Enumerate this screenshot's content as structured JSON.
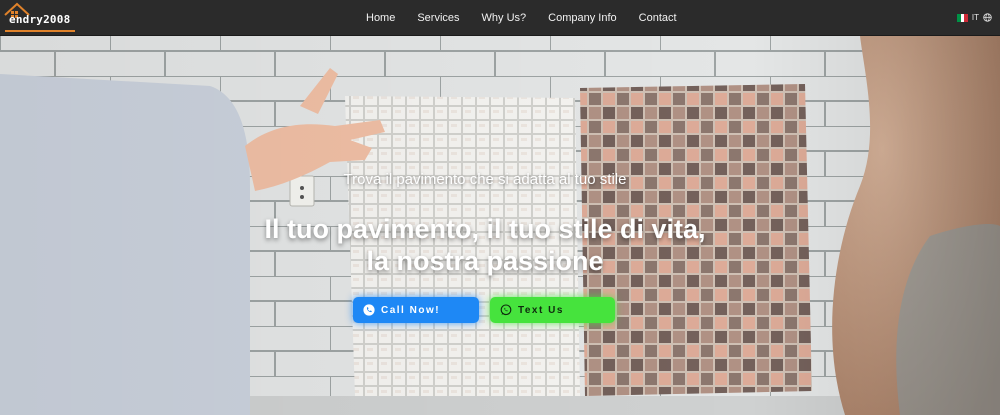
{
  "brand": {
    "logo_text": "endry2008",
    "accent": "#e0822a"
  },
  "nav": {
    "links": [
      "Home",
      "Services",
      "Why Us?",
      "Company Info",
      "Contact"
    ],
    "language": "IT",
    "flag_colors": [
      "#009246",
      "#ffffff",
      "#ce2b37"
    ]
  },
  "hero": {
    "tagline": "Trova il pavimento che si adatta al tuo stile",
    "headline_line1": "Il tuo pavimento, il tuo stile di vita,",
    "headline_line2": "la nostra passione",
    "buttons": {
      "call_label": "Call Now!",
      "call_color": "#1e88f5",
      "text_label": "Text Us",
      "text_color": "#46e33d"
    }
  },
  "icons": {
    "logo": "house-roof-icon",
    "language": "globe-icon",
    "call": "phone-icon",
    "text": "whatsapp-icon"
  }
}
